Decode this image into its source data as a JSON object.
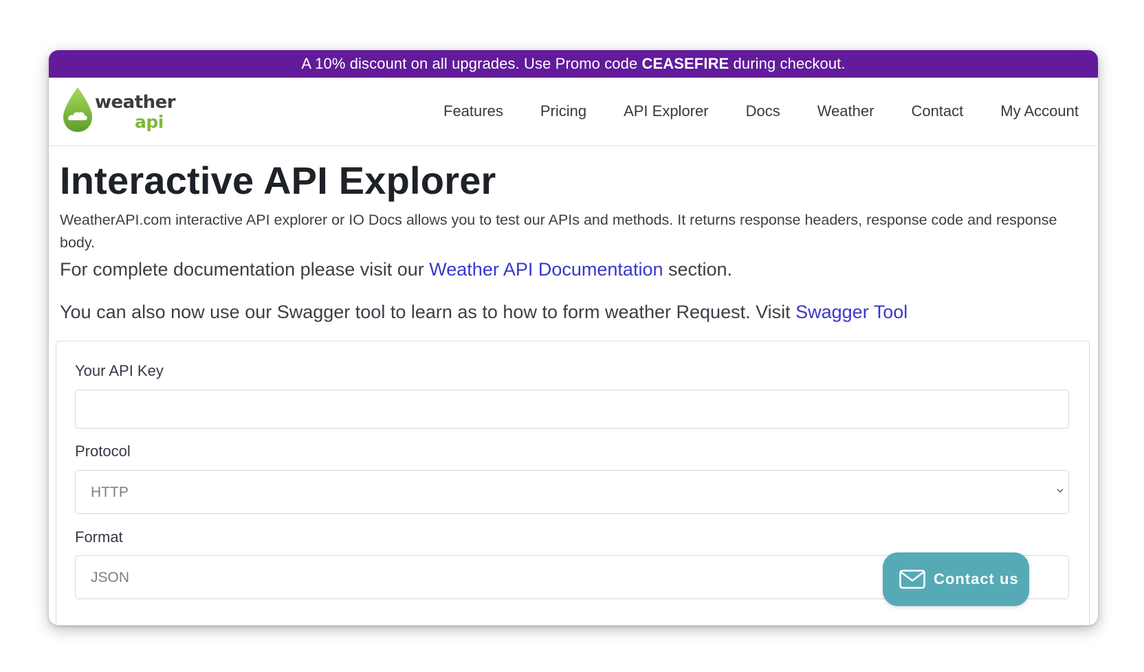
{
  "promo": {
    "before": "A 10% discount on all upgrades. Use Promo code ",
    "code": "CEASEFIRE",
    "after": " during checkout.",
    "background": "#621b9a"
  },
  "logo": {
    "word1": "weather",
    "word2": "api",
    "icon": "water-drop-cloud-icon"
  },
  "nav": {
    "items": [
      "Features",
      "Pricing",
      "API Explorer",
      "Docs",
      "Weather",
      "Contact",
      "My Account"
    ]
  },
  "page": {
    "title": "Interactive API Explorer",
    "lead": "WeatherAPI.com interactive API explorer or IO Docs allows you to test our APIs and methods. It returns response headers, response code and response body.",
    "doc_before": "For complete documentation please visit our ",
    "doc_link": "Weather API Documentation",
    "doc_after": " section.",
    "swagger_before": "You can also now use our Swagger tool to learn as to how to form weather Request. Visit ",
    "swagger_link": "Swagger Tool",
    "link_color": "#3a37cc"
  },
  "form": {
    "api_key_label": "Your API Key",
    "api_key_value": "",
    "protocol_label": "Protocol",
    "protocol_value": "HTTP",
    "format_label": "Format",
    "format_value": "JSON"
  },
  "contact": {
    "label": "Contact us",
    "icon": "mail-icon",
    "color": "#55aab6"
  }
}
